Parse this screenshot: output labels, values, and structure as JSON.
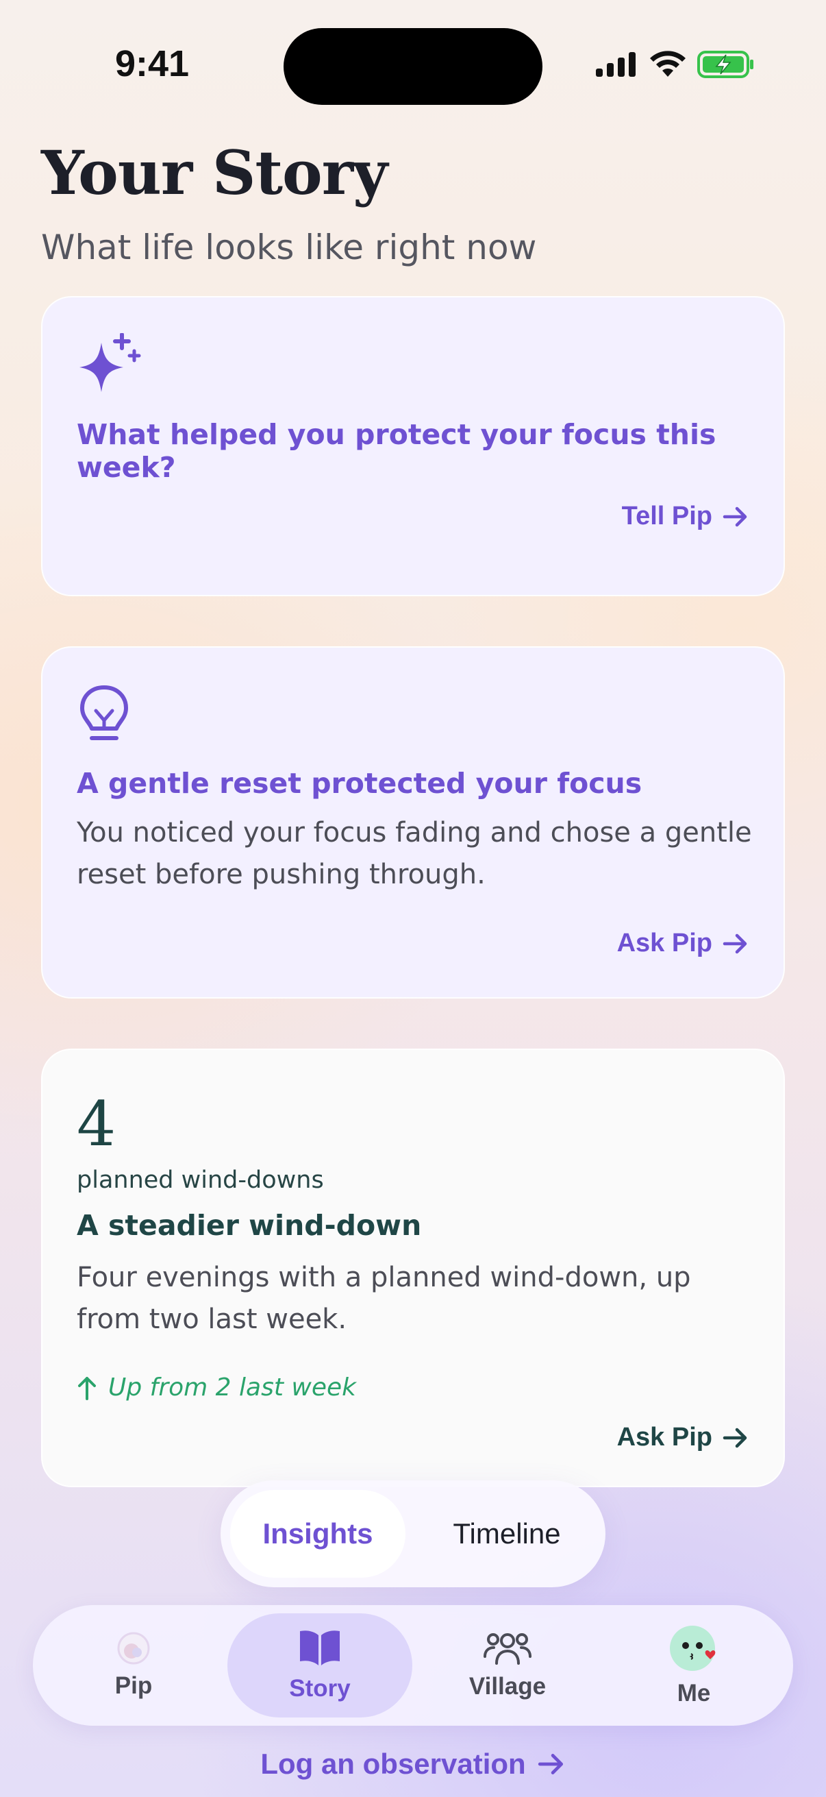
{
  "status_bar": {
    "time": "9:41"
  },
  "header": {
    "title": "Your Story",
    "subtitle": "What life looks like right now"
  },
  "prompt_card": {
    "icon": "sparkle-icon",
    "question": "What helped you protect your focus this week?",
    "action_label": "Tell Pip"
  },
  "insight_card": {
    "icon": "lightbulb-icon",
    "title": "A gentle reset protected your focus",
    "body": "You noticed your focus fading and chose a gentle reset before pushing through.",
    "action_label": "Ask Pip"
  },
  "stat_card": {
    "value": "4",
    "value_label": "planned wind-downs",
    "title": "A steadier wind-down",
    "body": "Four evenings with a planned wind-down, up from two last week.",
    "trend": "Up from 2 last week",
    "action_label": "Ask Pip"
  },
  "segment": {
    "items": [
      {
        "label": "Insights",
        "selected": true
      },
      {
        "label": "Timeline",
        "selected": false
      }
    ]
  },
  "tab_bar": {
    "items": [
      {
        "label": "Pip",
        "icon": "pip-orb-icon"
      },
      {
        "label": "Story",
        "icon": "book-icon",
        "selected": true
      },
      {
        "label": "Village",
        "icon": "people-icon"
      },
      {
        "label": "Me",
        "icon": "avatar-icon"
      }
    ]
  },
  "log_link": {
    "label": "Log an observation"
  },
  "colors": {
    "accent": "#6e51d2",
    "teal_text": "#1f4646",
    "trend_green": "#2aa36b",
    "card_lavender": "#f3f0ff"
  }
}
